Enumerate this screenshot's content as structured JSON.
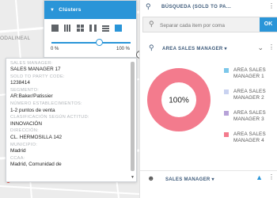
{
  "map": {
    "label": "ODALINEAL"
  },
  "clusters": {
    "title": "Clústers",
    "min_label": "0 %",
    "max_label": "100 %",
    "slider_value": 60
  },
  "info": {
    "fields": [
      {
        "label": "Sales Manager:",
        "value": "SALES MANAGER 17"
      },
      {
        "label": "Sold to Party Code:",
        "value": "1238414"
      },
      {
        "label": "Segmento:",
        "value": "AR:Baker/Patissier"
      },
      {
        "label": "Número establecimientos:",
        "value": "1-2 puntos de venta"
      },
      {
        "label": "Clasificación según Actitud:",
        "value": "INNOVACIÓN"
      },
      {
        "label": "Dirección:",
        "value": "CL. HERMOSILLA 142"
      },
      {
        "label": "Municipio:",
        "value": "Madrid"
      },
      {
        "label": "CCAA:",
        "value": "Madrid, Comunidad de"
      }
    ]
  },
  "search": {
    "header": "BÚSQUEDA (SOLD TO PA...",
    "placeholder": "Separar cada item por coma",
    "ok_label": "OK"
  },
  "area_panel": {
    "title": "AREA SALES MANAGER ▾"
  },
  "chart_data": {
    "type": "pie",
    "donut": true,
    "center_label": "100%",
    "categories": [
      "AREA SALES MANAGER 1",
      "AREA SALES MANAGER 2",
      "AREA SALES MANAGER 3",
      "AREA SALES MANAGER 4"
    ],
    "values": [
      0,
      0,
      0,
      100
    ],
    "colors": [
      "#7cc7ea",
      "#c9d2f0",
      "#b7a2d8",
      "#f37b8d"
    ],
    "legend_position": "right"
  },
  "sales_panel": {
    "title": "SALES MANAGER ▾"
  }
}
